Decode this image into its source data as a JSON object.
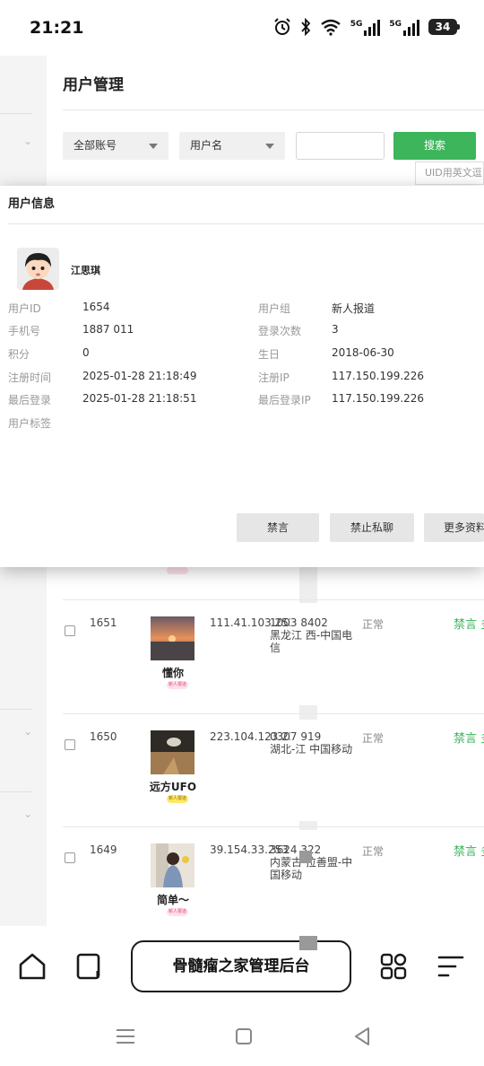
{
  "status_bar": {
    "time": "21:21",
    "network1": "5G",
    "network2": "5G",
    "battery": "34"
  },
  "page": {
    "title": "用户管理",
    "filter_account": "全部账号",
    "filter_field": "用户名",
    "search_placeholder": "",
    "search_button": "搜索",
    "uid_hint": "UID用英文逗"
  },
  "popup": {
    "title": "用户信息",
    "user_name": "江思琪",
    "fields_left": [
      {
        "label": "用户ID",
        "value": "1654"
      },
      {
        "label": "手机号",
        "value": "1887 011"
      },
      {
        "label": "积分",
        "value": "0"
      },
      {
        "label": "注册时间",
        "value": "2025-01-28 21:18:49"
      },
      {
        "label": "最后登录",
        "value": "2025-01-28 21:18:51"
      },
      {
        "label": "用户标签",
        "value": ""
      }
    ],
    "fields_right": [
      {
        "label": "用户组",
        "value": "新人报道"
      },
      {
        "label": "登录次数",
        "value": "3"
      },
      {
        "label": "生日",
        "value": "2018-06-30"
      },
      {
        "label": "注册IP",
        "value": "117.150.199.226"
      },
      {
        "label": "最后登录IP",
        "value": "117.150.199.226"
      }
    ],
    "buttons": [
      "禁言",
      "禁止私聊",
      "更多资料"
    ]
  },
  "rows": [
    {
      "uid": "1651",
      "nickname": "懂你",
      "tag": "新人报道",
      "ip": "111.41.103.253",
      "loc_1": "1003 8402",
      "loc_2": "黑龙江 西-中国电",
      "loc_3": "信",
      "status": "正常",
      "action": "禁言 多"
    },
    {
      "uid": "1650",
      "nickname": "远方UFO",
      "tag": "新人报道",
      "ip": "223.104.123.238",
      "loc_1": "0307 919",
      "loc_2": "湖北-江 中国移动",
      "loc_3": "",
      "status": "正常",
      "action": "禁言 多"
    },
    {
      "uid": "1649",
      "nickname": "简单～",
      "tag": "新人报道",
      "ip": "39.154.33.253",
      "loc_1": "3624 322",
      "loc_2": "内蒙古 拉善盟-中",
      "loc_3": "国移动",
      "status": "正常",
      "action": "禁言 多"
    }
  ],
  "bottom": {
    "site_name": "骨髓瘤之家管理后台"
  },
  "colors": {
    "accent_green": "#3cb55b",
    "tag_pink": "#fde0ea",
    "tag_yellow": "#ffe96a"
  }
}
